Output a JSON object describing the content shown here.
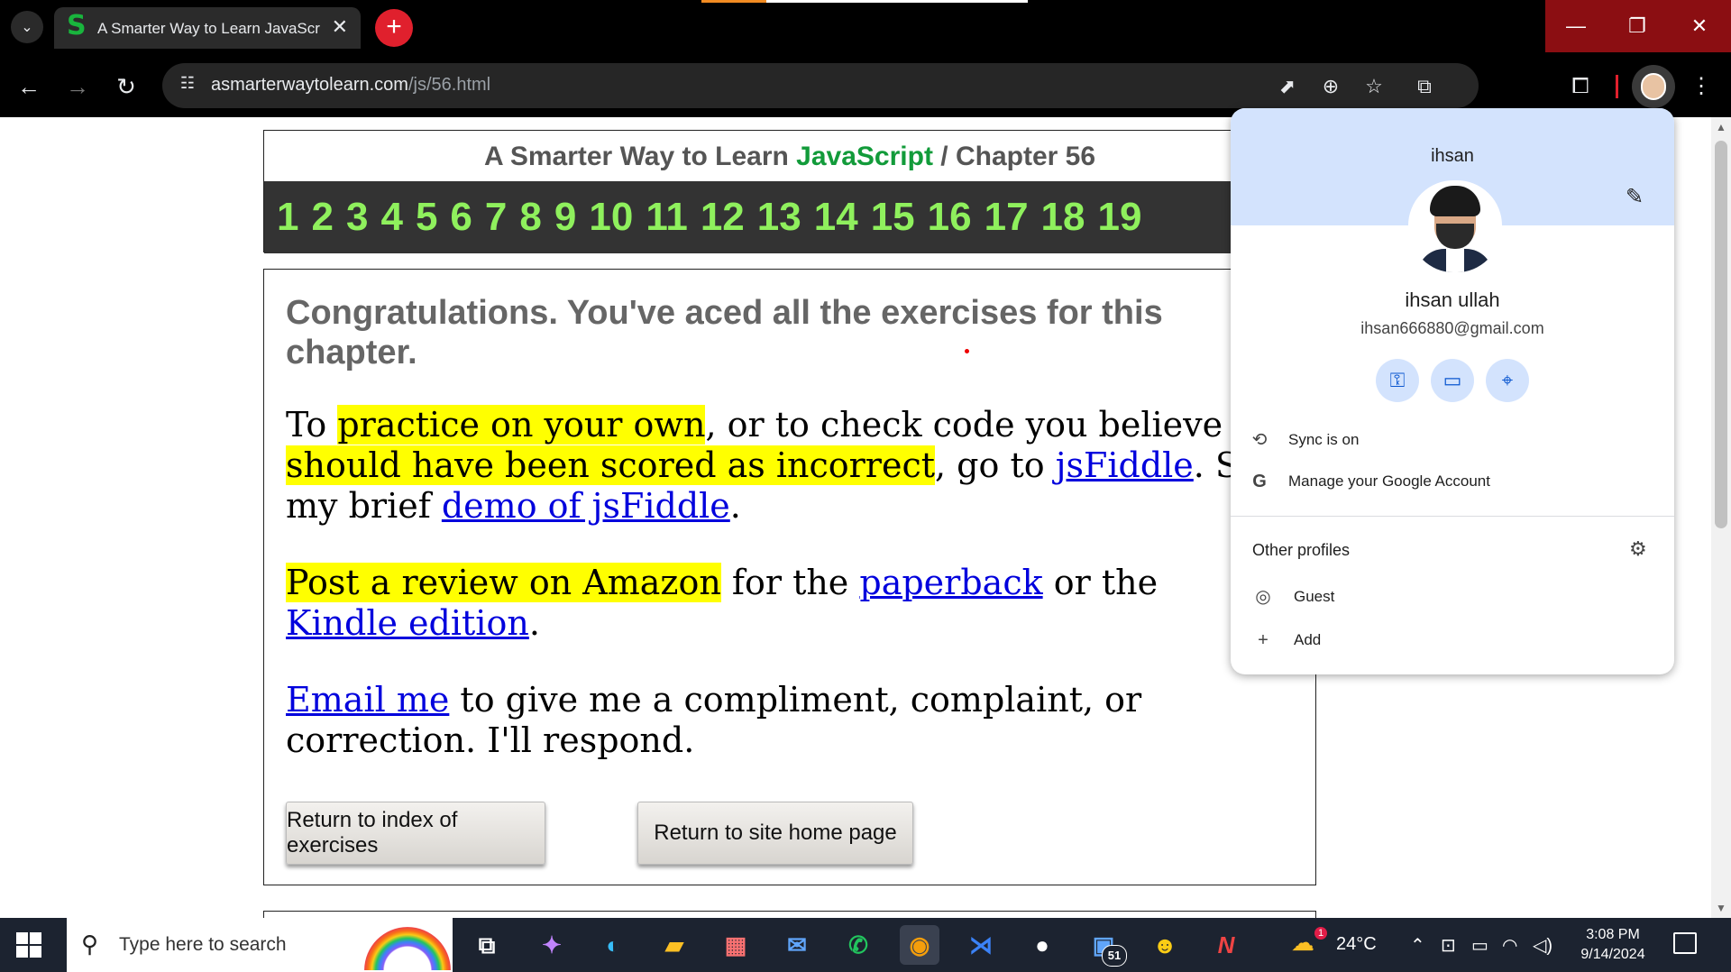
{
  "browser": {
    "tab": {
      "title": "A Smarter Way to Learn JavaScr",
      "favicon": "S"
    },
    "url": {
      "domain": "asmarterwaytolearn.com",
      "path": "/js/56.html"
    },
    "colors": {
      "frame": "#000000",
      "accent_close": "#8b0e12",
      "new_tab": "#e0202d"
    }
  },
  "page": {
    "header": {
      "prefix": "A Smarter Way to Learn",
      "brand": "JavaScript",
      "separator": "/",
      "chapter": "Chapter 56"
    },
    "chapters": [
      "1",
      "2",
      "3",
      "4",
      "5",
      "6",
      "7",
      "8",
      "9",
      "10",
      "11",
      "12",
      "13",
      "14",
      "15",
      "16",
      "17",
      "18",
      "19"
    ],
    "congrats": "Congratulations. You've aced all the exercises for this chapter.",
    "p1": {
      "t1": "To ",
      "hl1": "practice on your own",
      "t2": ", or to check code you believe ",
      "hl2": "should have been scored as incorrect",
      "t3": ", go to ",
      "link1": "jsFiddle",
      "t4": ". See my brief ",
      "link2": "demo of jsFiddle",
      "t5": "."
    },
    "p2": {
      "hl": "Post a review on Amazon",
      "t1": " for the ",
      "link1": "paperback",
      "t2": " or the ",
      "link2": "Kindle edition",
      "t3": "."
    },
    "p3": {
      "link": "Email me",
      "t1": " to give me a compliment, complaint, or correction. I'll respond."
    },
    "buttons": {
      "index": "Return to index of exercises",
      "home": "Return to site home page"
    }
  },
  "profile_menu": {
    "profile_name": "ihsan",
    "full_name": "ihsan ullah",
    "email": "ihsan666880@gmail.com",
    "sync": "Sync is on",
    "manage": "Manage your Google Account",
    "other_profiles": "Other profiles",
    "guest": "Guest",
    "add": "Add"
  },
  "taskbar": {
    "search_placeholder": "Type here to search",
    "weather": "24°C",
    "weather_badge": "1",
    "mail_badge": "51",
    "time": "3:08 PM",
    "date": "9/14/2024"
  }
}
